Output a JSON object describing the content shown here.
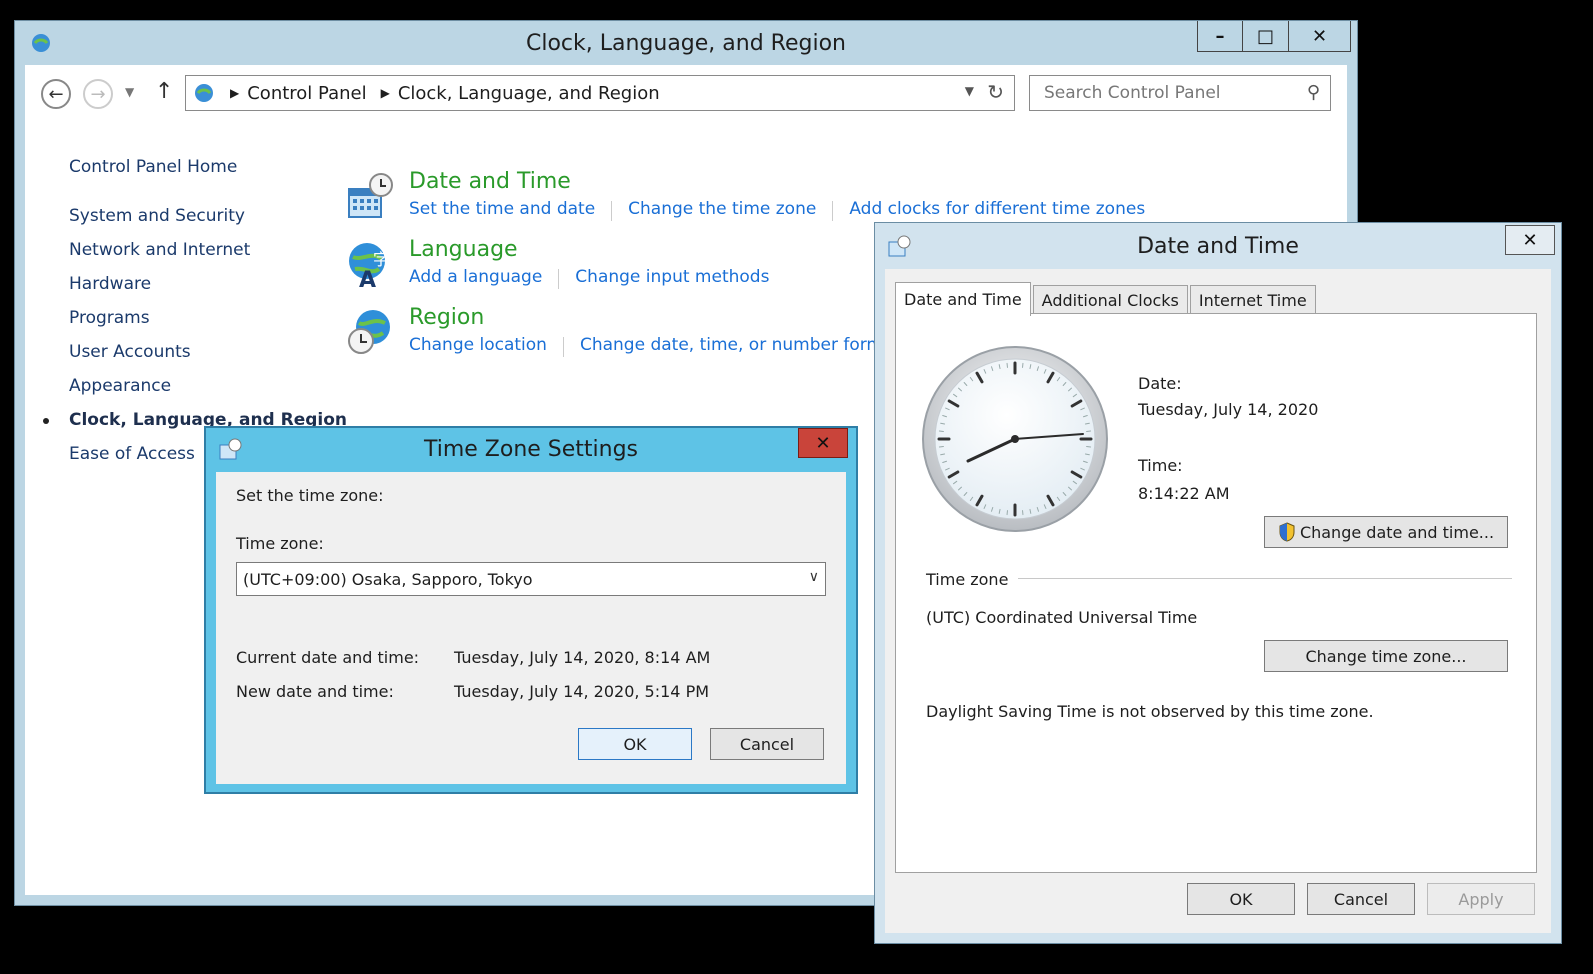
{
  "control_panel": {
    "title": "Clock, Language, and Region",
    "caption": {
      "minimize": "–",
      "maximize": "□",
      "close": "✕"
    },
    "breadcrumb": [
      "Control Panel",
      "Clock, Language, and Region"
    ],
    "search_placeholder": "Search Control Panel",
    "sidebar": {
      "home": "Control Panel Home",
      "items": [
        "System and Security",
        "Network and Internet",
        "Hardware",
        "Programs",
        "User Accounts",
        "Appearance",
        "Clock, Language, and Region",
        "Ease of Access"
      ],
      "active_index": 6
    },
    "categories": [
      {
        "title": "Date and Time",
        "links": [
          "Set the time and date",
          "Change the time zone",
          "Add clocks for different time zones"
        ]
      },
      {
        "title": "Language",
        "links": [
          "Add a language",
          "Change input methods"
        ]
      },
      {
        "title": "Region",
        "links": [
          "Change location",
          "Change date, time, or number formats"
        ]
      }
    ]
  },
  "time_zone_dialog": {
    "title": "Time Zone Settings",
    "close": "✕",
    "intro": "Set the time zone:",
    "zone_label": "Time zone:",
    "zone_value": "(UTC+09:00) Osaka, Sapporo, Tokyo",
    "current_label": "Current date and time:",
    "current_value": "Tuesday, July 14, 2020, 8:14 AM",
    "new_label": "New date and time:",
    "new_value": "Tuesday, July 14, 2020, 5:14 PM",
    "ok": "OK",
    "cancel": "Cancel"
  },
  "date_time_dialog": {
    "title": "Date and Time",
    "close": "✕",
    "tabs": [
      "Date and Time",
      "Additional Clocks",
      "Internet Time"
    ],
    "date_label": "Date:",
    "date_value": "Tuesday, July 14, 2020",
    "time_label": "Time:",
    "time_value": "8:14:22 AM",
    "change_datetime_button": "Change date and time...",
    "timezone_group": "Time zone",
    "timezone_value": "(UTC) Coordinated Universal Time",
    "change_timezone_button": "Change time zone...",
    "dst_note": "Daylight Saving Time is not observed by this time zone.",
    "ok": "OK",
    "cancel": "Cancel",
    "apply": "Apply"
  },
  "colors": {
    "link": "#1a6fd6",
    "category_title": "#2a9a2a",
    "cp_frame": "#bcd6e4",
    "tz_frame": "#5ec3e6",
    "close_red": "#c9443a"
  }
}
